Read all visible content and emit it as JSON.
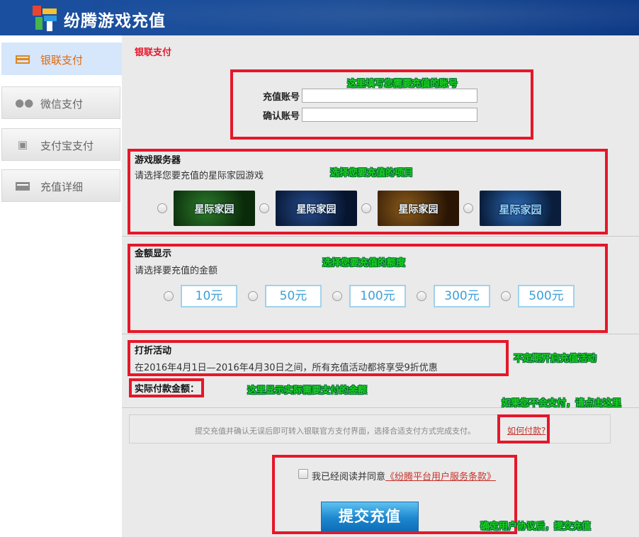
{
  "header": {
    "title": "纷腾游戏充值"
  },
  "sidebar": {
    "items": [
      {
        "label": "银联支付",
        "icon": "card-icon",
        "active": true
      },
      {
        "label": "微信支付",
        "icon": "wechat-icon",
        "active": false
      },
      {
        "label": "支付宝支付",
        "icon": "alipay-icon",
        "active": false
      },
      {
        "label": "充值详细",
        "icon": "card-icon",
        "active": false
      }
    ]
  },
  "main": {
    "page_title": "银联支付",
    "account": {
      "recharge_label": "充值账号",
      "confirm_label": "确认账号",
      "recharge_value": "",
      "confirm_value": ""
    },
    "server": {
      "title": "游戏服务器",
      "desc": "请选择您要充值的星际家园游戏",
      "games": [
        "星际家园",
        "星际家园",
        "星际家园",
        "星际家园"
      ]
    },
    "amount": {
      "title": "金额显示",
      "desc": "请选择要充值的金额",
      "options": [
        "10元",
        "50元",
        "100元",
        "300元",
        "500元"
      ]
    },
    "discount": {
      "title": "打折活动",
      "desc": "在2016年4月1日—2016年4月30日之间，所有充值活动都将享受9折优惠"
    },
    "actual_amount_label": "实际付款金额：",
    "info": {
      "text": "提交充值并确认无误后即可转入银联官方支付界面，选择合适支付方式完成支付。",
      "link": "如何付款?"
    },
    "agreement": {
      "text": "我已经阅读并同意",
      "link": "《纷腾平台用户服务条款》"
    },
    "submit_label": "提交充值"
  },
  "annotations": {
    "account": "这里填写您需要充值的账号",
    "game": "选择您要充值的项目",
    "amount": "选择您要充值的额度",
    "discount": "不定期开启充值活动",
    "actual": "这里显示实际需要支付的金额",
    "howpay": "如果您不会支付，请点击这里",
    "submit": "确定用户协议后，提交充值"
  },
  "colors": {
    "header": "#1a4fa0",
    "active_tab": "#d6e6fb",
    "highlight_border": "#e5172a",
    "annotation": "#1cd21c",
    "link": "#c5322a"
  }
}
